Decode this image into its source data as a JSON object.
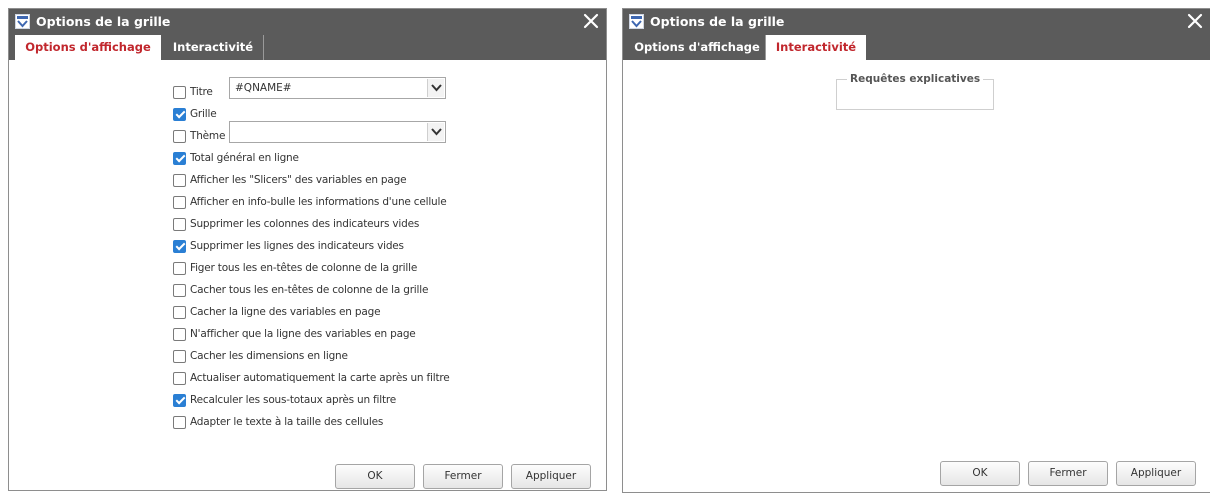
{
  "left_dialog": {
    "title": "Options de la grille",
    "tabs": [
      {
        "label": "Options d'affichage",
        "active": true
      },
      {
        "label": "Interactivité",
        "active": false
      }
    ],
    "title_field": {
      "label": "Titre",
      "checked": false,
      "value": "#QNAME#"
    },
    "grid_option": {
      "label": "Grille",
      "checked": true
    },
    "theme_field": {
      "label": "Thème",
      "checked": false,
      "value": ""
    },
    "options": [
      {
        "label": "Total général en ligne",
        "checked": true
      },
      {
        "label": "Afficher les \"Slicers\" des variables en page",
        "checked": false
      },
      {
        "label": "Afficher en info-bulle les informations d'une cellule",
        "checked": false
      },
      {
        "label": "Supprimer les colonnes des indicateurs vides",
        "checked": false
      },
      {
        "label": "Supprimer les lignes des indicateurs vides",
        "checked": true
      },
      {
        "label": "Figer tous les en-têtes de colonne de la grille",
        "checked": false
      },
      {
        "label": "Cacher tous les en-têtes de colonne de la grille",
        "checked": false
      },
      {
        "label": "Cacher la ligne des variables en page",
        "checked": false
      },
      {
        "label": "N'afficher que la ligne des variables en page",
        "checked": false
      },
      {
        "label": "Cacher les dimensions en ligne",
        "checked": false
      },
      {
        "label": "Actualiser automatiquement la carte après un filtre",
        "checked": false
      },
      {
        "label": "Recalculer les sous-totaux après un filtre",
        "checked": true
      },
      {
        "label": "Adapter le texte à la taille des cellules",
        "checked": false
      }
    ],
    "buttons": {
      "ok": "OK",
      "close": "Fermer",
      "apply": "Appliquer"
    }
  },
  "right_dialog": {
    "title": "Options de la grille",
    "tabs": [
      {
        "label": "Options d'affichage",
        "active": false
      },
      {
        "label": "Interactivité",
        "active": true
      }
    ],
    "group_title": "Requêtes explicatives",
    "buttons": {
      "ok": "OK",
      "close": "Fermer",
      "apply": "Appliquer"
    }
  },
  "icons": {
    "title_icon": "grid-options-icon",
    "close": "close-icon",
    "dropdown": "chevron-down-icon",
    "checkbox_checked": "check-icon"
  },
  "colors": {
    "titlebar": "#5b5b5b",
    "active_tab_text": "#c1272d",
    "checkbox_on": "#2a7fd4"
  }
}
